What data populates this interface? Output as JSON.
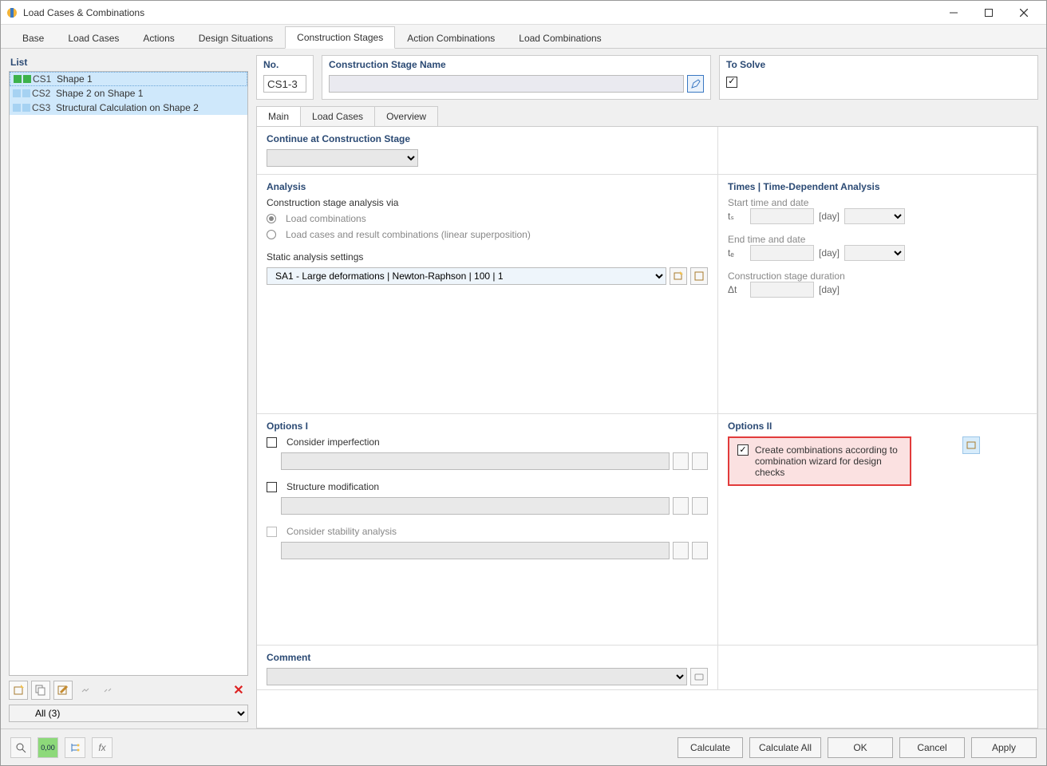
{
  "window": {
    "title": "Load Cases & Combinations"
  },
  "tabs": {
    "base": "Base",
    "loadcases": "Load Cases",
    "actions": "Actions",
    "design": "Design Situations",
    "stages": "Construction Stages",
    "actcomb": "Action Combinations",
    "loadcomb": "Load Combinations"
  },
  "list": {
    "head": "List",
    "items": [
      {
        "code": "CS1",
        "name": "Shape 1",
        "sel": true,
        "c1": "green",
        "c2": "green"
      },
      {
        "code": "CS2",
        "name": "Shape 2 on Shape 1",
        "sel": false,
        "c1": "blue",
        "c2": "blue"
      },
      {
        "code": "CS3",
        "name": "Structural Calculation on Shape 2",
        "sel": false,
        "c1": "blue",
        "c2": "blue"
      }
    ],
    "filter": "All (3)"
  },
  "fields": {
    "no_lbl": "No.",
    "no_val": "CS1-3",
    "name_lbl": "Construction Stage Name",
    "name_val": "",
    "solve_lbl": "To Solve"
  },
  "dtabs": {
    "main": "Main",
    "loadcases": "Load Cases",
    "overview": "Overview"
  },
  "secs": {
    "continue": "Continue at Construction Stage",
    "analysis": "Analysis",
    "cs_via": "Construction stage analysis via",
    "r_loadcomb": "Load combinations",
    "r_loadcases": "Load cases and result combinations (linear superposition)",
    "static_lbl": "Static analysis settings",
    "static_val": "SA1 - Large deformations | Newton-Raphson | 100 | 1",
    "times": "Times | Time-Dependent Analysis",
    "t_start": "Start time and date",
    "t_end": "End time and date",
    "t_dur": "Construction stage duration",
    "ts": "tₛ",
    "te": "tₑ",
    "dt": "Δt",
    "day": "[day]",
    "opt1": "Options I",
    "opt2": "Options II",
    "imperf": "Consider imperfection",
    "struct": "Structure modification",
    "stab": "Consider stability analysis",
    "createcomb": "Create combinations according to combination wizard for design checks",
    "comment": "Comment"
  },
  "footer": {
    "calc": "Calculate",
    "calcall": "Calculate All",
    "ok": "OK",
    "cancel": "Cancel",
    "apply": "Apply"
  }
}
